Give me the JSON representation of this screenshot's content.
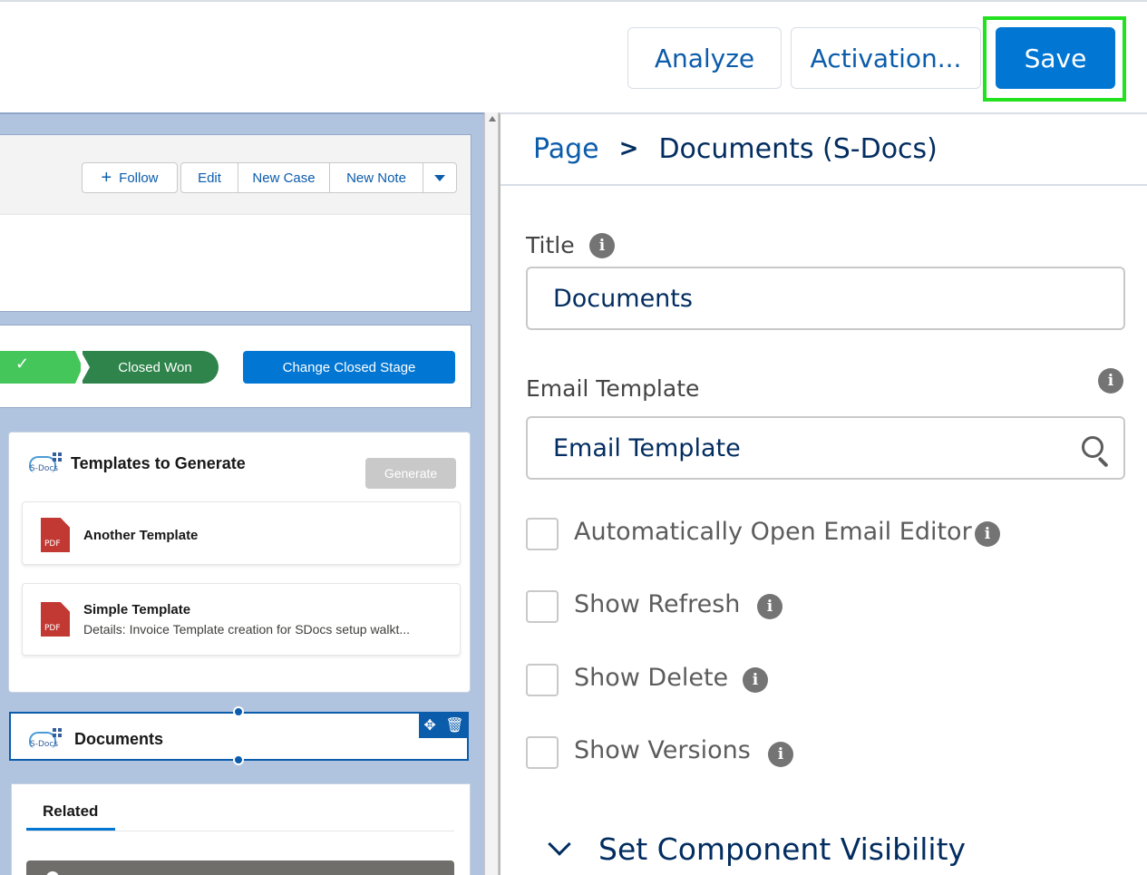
{
  "toolbar": {
    "analyze_label": "Analyze",
    "activation_label": "Activation...",
    "save_label": "Save"
  },
  "canvas": {
    "header_actions": {
      "follow": "Follow",
      "edit": "Edit",
      "new_case": "New Case",
      "new_note": "New Note"
    },
    "path": {
      "stage": "Closed Won",
      "change_button": "Change Closed Stage"
    },
    "sdocs_logo_text": "S-Docs",
    "templates_card": {
      "title": "Templates to Generate",
      "generate_button": "Generate",
      "items": [
        {
          "name": "Another Template",
          "detail": "",
          "icon_text": "PDF"
        },
        {
          "name": "Simple Template",
          "detail": "Details: Invoice Template creation for SDocs setup walkt...",
          "icon_text": "PDF"
        }
      ]
    },
    "documents_card": {
      "title": "Documents"
    },
    "related": {
      "tab": "Related"
    }
  },
  "panel": {
    "breadcrumb": {
      "root": "Page",
      "separator": ">",
      "current": "Documents (S-Docs)"
    },
    "title_field": {
      "label": "Title",
      "value": "Documents"
    },
    "email_template_field": {
      "label": "Email Template",
      "value": "Email Template"
    },
    "checkboxes": [
      {
        "label": "Automatically Open Email Editor",
        "checked": false
      },
      {
        "label": "Show Refresh",
        "checked": false
      },
      {
        "label": "Show Delete",
        "checked": false
      },
      {
        "label": "Show Versions",
        "checked": false
      }
    ],
    "visibility_section": "Set Component Visibility"
  },
  "colors": {
    "brand_blue": "#0176d3",
    "highlight_green": "#22e21f",
    "path_green": "#2e844a",
    "pdf_red": "#c23934"
  }
}
